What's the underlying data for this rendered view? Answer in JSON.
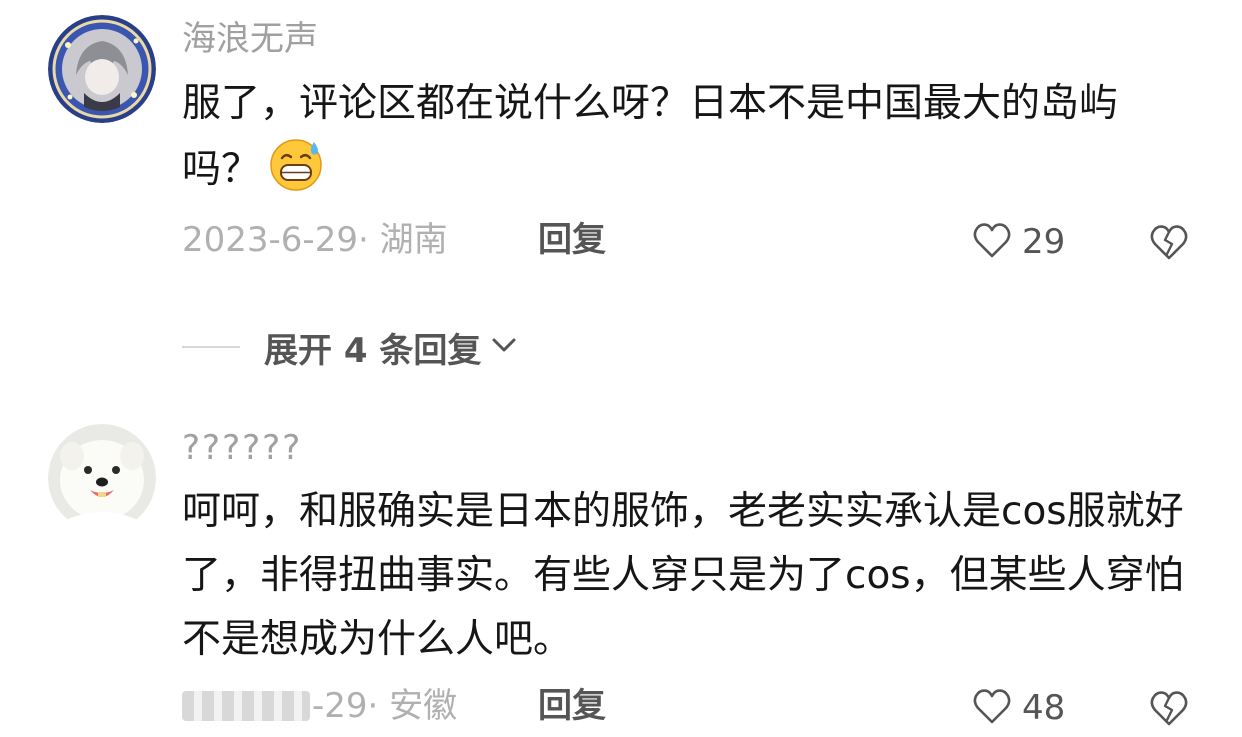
{
  "comments": [
    {
      "username": "海浪无声",
      "text": "服了，评论区都在说什么呀？日本不是中国最大的岛屿吗？",
      "emoji": "grinning-sweat-emoji",
      "meta": "2023-6-29· 湖南",
      "reply_label": "回复",
      "likes": "29"
    },
    {
      "username": "??????",
      "text": "呵呵，和服确实是日本的服饰，老老实实承认是cos服就好了，非得扭曲事实。有些人穿只是为了cos，但某些人穿怕不是想成为什么人吧。",
      "meta": "-29· 安徽",
      "reply_label": "回复",
      "likes": "48"
    }
  ],
  "expand_replies": {
    "label": "展开 4 条回复"
  },
  "colors": {
    "text": "#161616",
    "muted": "#a0a0a0",
    "icon": "#555555"
  },
  "icons": [
    "heart-outline-icon",
    "broken-heart-icon",
    "chevron-down-icon"
  ]
}
